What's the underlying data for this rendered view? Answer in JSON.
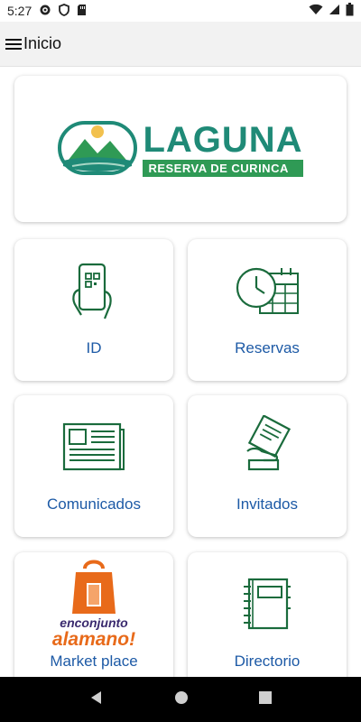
{
  "status": {
    "time": "5:27"
  },
  "app_bar": {
    "title": "Inicio"
  },
  "logo": {
    "name": "LAGUNA",
    "subtitle": "RESERVA DE CURINCA"
  },
  "tiles": [
    {
      "label": "ID",
      "icon": "phone-qr-icon"
    },
    {
      "label": "Reservas",
      "icon": "clock-calendar-icon"
    },
    {
      "label": "Comunicados",
      "icon": "newspaper-icon"
    },
    {
      "label": "Invitados",
      "icon": "ticket-hand-icon"
    },
    {
      "label": "Market place",
      "icon": "enconjunto-bag-logo",
      "brand": {
        "top": "enconjunto",
        "bottom": "alamano!"
      }
    },
    {
      "label": "Directorio",
      "icon": "notebook-icon"
    }
  ],
  "colors": {
    "accent_green": "#1a6b3c",
    "teal": "#1f8a77",
    "label_blue": "#1d5aa6",
    "brand_orange": "#e86a1a"
  }
}
